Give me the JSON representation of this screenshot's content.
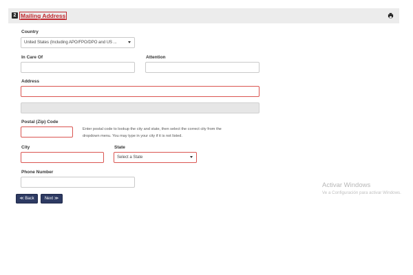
{
  "header": {
    "step_number": "2",
    "title": "Mailing Address"
  },
  "form": {
    "country": {
      "label": "Country",
      "value": "United States (Including APO/FPO/DPO and US ..."
    },
    "in_care_of": {
      "label": "In Care Of",
      "value": ""
    },
    "attention": {
      "label": "Attention",
      "value": ""
    },
    "address": {
      "label": "Address",
      "value": "",
      "line2_value": ""
    },
    "postal": {
      "label": "Postal (Zip) Code",
      "value": "",
      "help_line1": "Enter postal code to lookup the city and state, then select the correct city from the",
      "help_line2": "dropdown menu. You may type in your city if it is not listed."
    },
    "city": {
      "label": "City",
      "value": ""
    },
    "state": {
      "label": "State",
      "value": "Select a State"
    },
    "phone": {
      "label": "Phone Number",
      "value": ""
    }
  },
  "buttons": {
    "back": "≪ Back",
    "next": "Next ≫"
  },
  "watermark": {
    "title": "Activar Windows",
    "subtitle": "Ve a Configuración para activar Windows."
  },
  "colors": {
    "error_border": "#d9534f",
    "title_red": "#c0272d",
    "button_bg": "#2d3a62"
  }
}
